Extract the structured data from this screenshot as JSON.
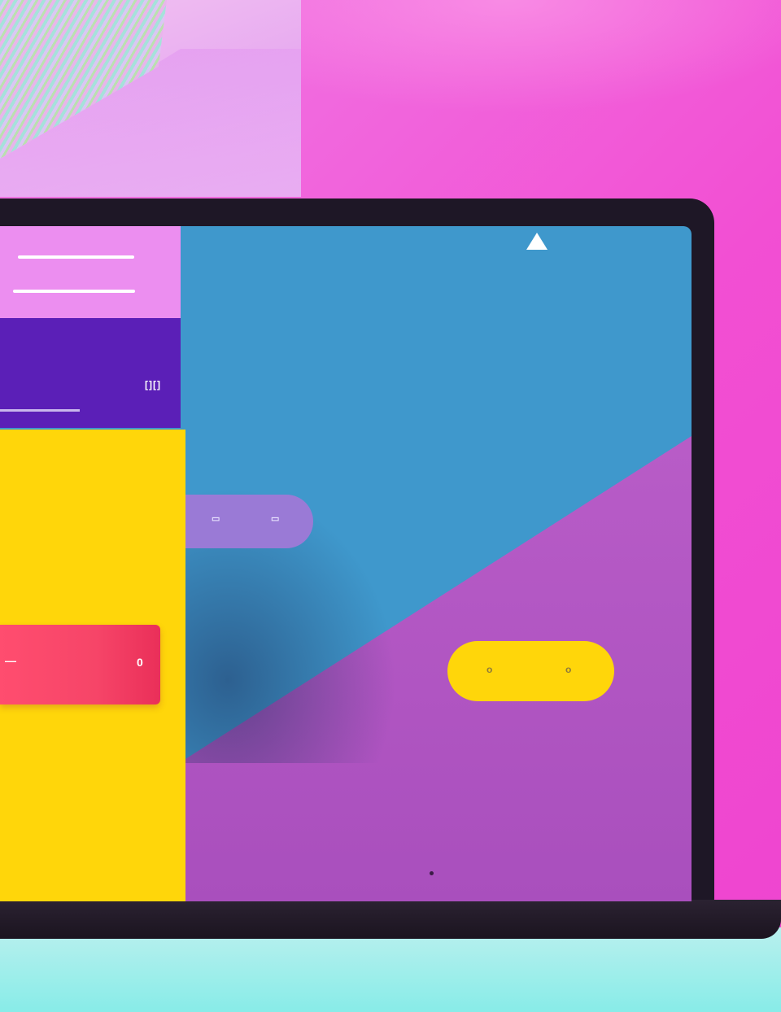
{
  "colors": {
    "background": "#f24fd3",
    "bezel": "#1e1726",
    "screen_blue": "#3f98cc",
    "screen_magenta": "#bf62cc",
    "panel_pink": "#ec8ef0",
    "panel_purple": "#5b1fb7",
    "panel_yellow": "#ffd60a",
    "bar_red": "#f64568",
    "pill_lavender": "#9a7ad6",
    "pill_yellow": "#ffd60a",
    "floor": "#a3eeec"
  },
  "icons": {
    "triangle": "up-triangle-icon",
    "menu": "hamburger-menu-icon"
  },
  "purple_panel": {
    "glyph": "[][]"
  },
  "red_bar": {
    "left_glyph": "—",
    "right_glyph": "0"
  },
  "lavender_pill": {
    "left_glyph": "▭",
    "right_glyph": "▭"
  },
  "yellow_pill": {
    "left_glyph": "o",
    "right_glyph": "o"
  }
}
